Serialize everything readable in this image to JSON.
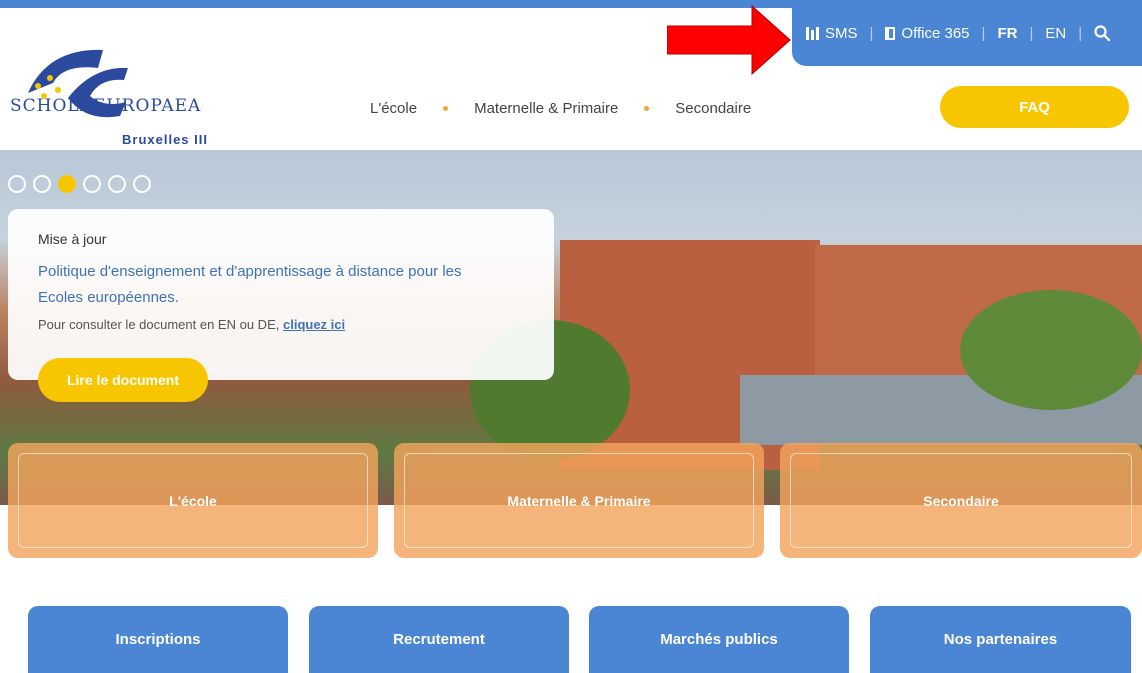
{
  "utility_bar": {
    "sms_label": "SMS",
    "office_label": "Office 365",
    "lang_fr": "FR",
    "lang_en": "EN",
    "separator": "|"
  },
  "logo": {
    "wordmark": "SCHOLAEUROPAEA",
    "campus": "Bruxelles III"
  },
  "main_nav": {
    "items": [
      "L'école",
      "Maternelle & Primaire",
      "Secondaire"
    ],
    "faq_label": "FAQ"
  },
  "hero": {
    "carousel_count": 6,
    "active_slide": 3,
    "eyebrow": "Mise à jour",
    "headline": "Politique d'enseignement et d'apprentissage à distance pour les Ecoles européennes.",
    "body_prefix": "Pour consulter le document en EN ou DE,",
    "body_link": "cliquez ici",
    "cta_label": "Lire le document"
  },
  "tiles": [
    "L'école",
    "Maternelle & Primaire",
    "Secondaire"
  ],
  "quick_links": [
    "Inscriptions",
    "Recrutement",
    "Marchés publics",
    "Nos partenaires"
  ],
  "colors": {
    "primary_blue": "#4a86d4",
    "accent_yellow": "#f7c600",
    "tile_orange": "#f3a35b",
    "link_blue": "#3f73b5",
    "annotation_red": "#ff0000"
  }
}
